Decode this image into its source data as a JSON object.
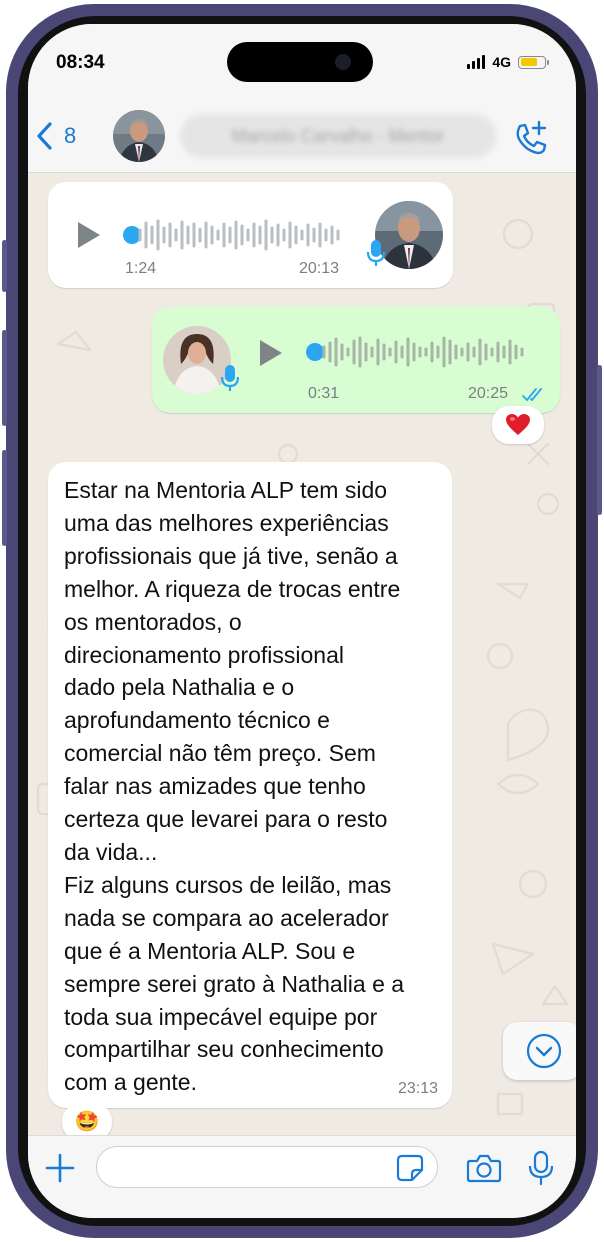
{
  "status_bar": {
    "time": "08:34",
    "network": "4G"
  },
  "header": {
    "back_count": "8",
    "contact_name": "Marcelo Carvalho - Mentor",
    "contact_name_blurred": true
  },
  "messages": [
    {
      "type": "voice",
      "direction": "incoming",
      "duration": "1:24",
      "time": "20:13"
    },
    {
      "type": "voice",
      "direction": "outgoing",
      "duration": "0:31",
      "time": "20:25",
      "read": true,
      "reaction": "❤️"
    },
    {
      "type": "text",
      "direction": "incoming",
      "text": "Estar na Mentoria ALP tem sido\numa das melhores experiências\nprofissionais que já tive, senão a\nmelhor. A riqueza de trocas entre\nos mentorados, o\ndirecionamento profissional\ndado pela Nathalia e o\naprofundamento técnico e\ncomercial não têm preço. Sem\nfalar nas amizades que tenho\ncerteza que levarei para o resto\nda vida...\nFiz alguns cursos de leilão, mas\nnada se compara ao acelerador\nque é a Mentoria ALP. Sou e\nsempre serei grato à Nathalia e a\ntoda sua impecável equipe por\ncompartilhar seu conhecimento\ncom a gente.",
      "time": "23:13",
      "reaction": "🤩"
    }
  ],
  "input": {
    "placeholder": ""
  },
  "colors": {
    "accent": "#1a7ad7",
    "outgoing_bubble": "#d8fdd2",
    "incoming_bubble": "#ffffff",
    "chat_background": "#efeae2",
    "voice_dot": "#2aa7f0",
    "phone_frame": "#4a4675"
  },
  "icons": [
    "back-chevron-icon",
    "call-plus-icon",
    "play-icon",
    "microphone-icon",
    "double-check-icon",
    "heart-icon",
    "chevron-down-icon",
    "plus-icon",
    "sticker-icon",
    "camera-icon"
  ]
}
